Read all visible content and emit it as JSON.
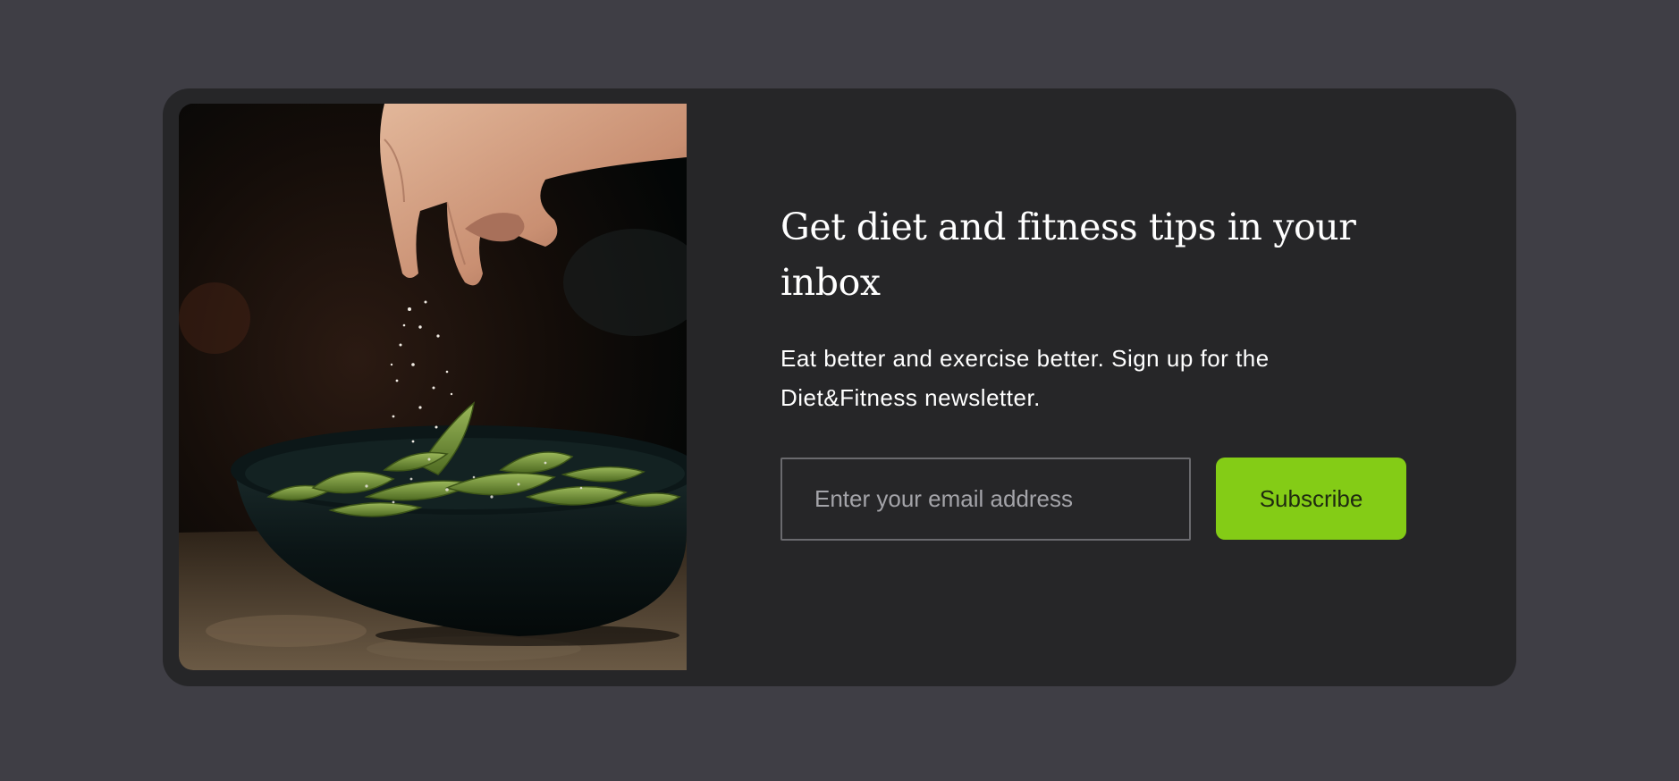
{
  "newsletter": {
    "headline": "Get diet and fitness tips in your inbox",
    "description": "Eat better and exercise better. Sign up for the Diet&Fitness newsletter.",
    "email_placeholder": "Enter your email address",
    "subscribe_label": "Subscribe",
    "image_subject": "hand sprinkling salt over bowl of edamame"
  },
  "colors": {
    "page_background": "#3f3e45",
    "card_background": "#262628",
    "accent": "#84cc16",
    "text": "#ffffff",
    "placeholder": "#a4a4a9"
  }
}
